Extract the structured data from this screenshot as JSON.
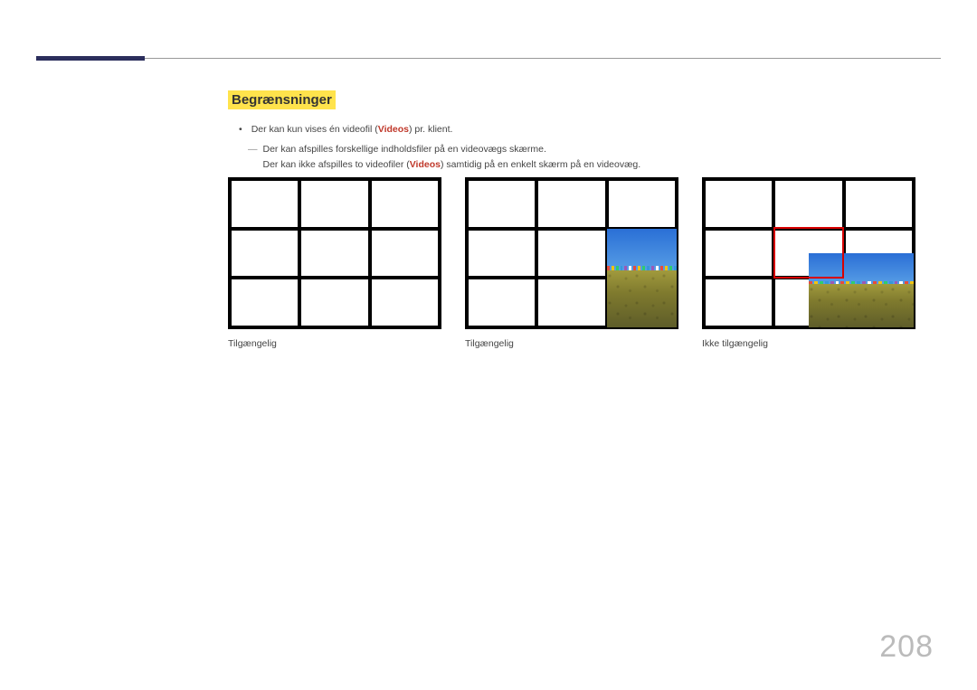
{
  "heading": "Begrænsninger",
  "bullet1_pre": "Der kan kun vises én videofil (",
  "bullet1_kw": "Videos",
  "bullet1_post": ") pr. klient.",
  "sub1": "Der kan afspilles forskellige indholdsfiler på en videovægs skærme.",
  "sub2_pre": "Der kan ikke afspilles to videofiler (",
  "sub2_kw": "Videos",
  "sub2_post": ") samtidig på en enkelt skærm på en videovæg.",
  "captions": {
    "d1": "Tilgængelig",
    "d2": "Tilgængelig",
    "d3": "Ikke tilgængelig"
  },
  "page_number": "208"
}
